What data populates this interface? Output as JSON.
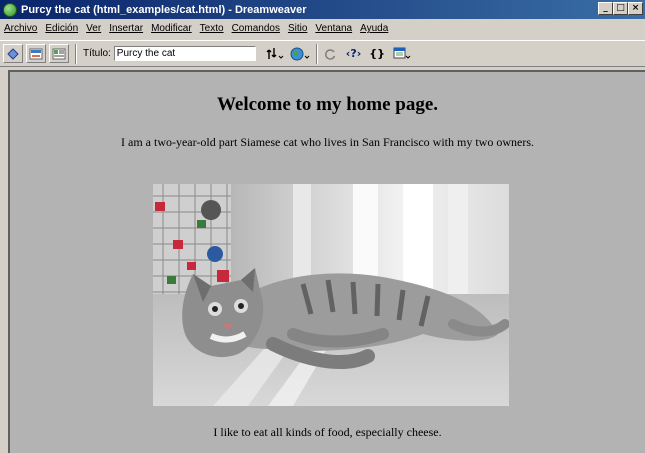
{
  "window": {
    "title": "Purcy the cat (html_examples/cat.html) - Dreamweaver",
    "controls": [
      "_",
      "□",
      "×"
    ]
  },
  "menu": [
    "Archivo",
    "Edición",
    "Ver",
    "Insertar",
    "Modificar",
    "Texto",
    "Comandos",
    "Sitio",
    "Ventana",
    "Ayuda"
  ],
  "toolbar": {
    "title_label": "Título:",
    "title_value": "Purcy the cat",
    "code_tools": [
      "‹?›",
      "{}"
    ]
  },
  "document": {
    "heading": "Welcome to my home page.",
    "intro": "I am a two-year-old part Siamese cat who lives in San Francisco with my two owners.",
    "image_subject": "cat lying on its side on carpet",
    "food": "I like to eat all kinds of food, especially cheese."
  }
}
